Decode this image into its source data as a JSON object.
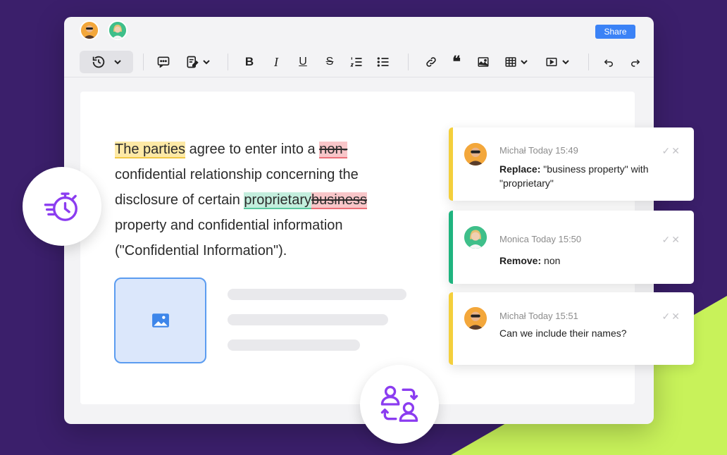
{
  "window": {
    "share_label": "Share"
  },
  "collaborators": [
    {
      "name": "Michał"
    },
    {
      "name": "Monica"
    }
  ],
  "toolbar": {
    "items": [
      "history",
      "comment",
      "track-changes",
      "bold",
      "italic",
      "underline",
      "strikethrough",
      "numbered-list",
      "bulleted-list",
      "link",
      "blockquote",
      "image",
      "table",
      "media",
      "undo",
      "redo"
    ]
  },
  "document": {
    "segments": {
      "s1": "The parties",
      "s2": " agree to enter into a ",
      "s3": "non-",
      "s4": " confidential relationship concerning the disclosure of certain ",
      "s5": "proprietary",
      "s6": "business",
      "s7": " property and confidential information (\"Confidential Information\")."
    }
  },
  "comments": [
    {
      "author": "Michał",
      "time": "Today 15:49",
      "action": "Replace:",
      "text": " \"business property\" with \"proprietary\"",
      "color": "#f4cf3c"
    },
    {
      "author": "Monica",
      "time": "Today 15:50",
      "action": "Remove:",
      "text": " non",
      "color": "#1fb47f"
    },
    {
      "author": "Michał",
      "time": "Today 15:51",
      "action": "",
      "text": "Can we include their names?",
      "color": "#f4cf3c"
    }
  ],
  "colors": {
    "background": "#3b1f6b",
    "accent_green": "#c8f25a",
    "accent_purple": "#8b3cf0",
    "share_blue": "#3b82f6"
  },
  "icons": {
    "left_bubble": "stopwatch-icon",
    "bottom_bubble": "users-swap-icon"
  }
}
